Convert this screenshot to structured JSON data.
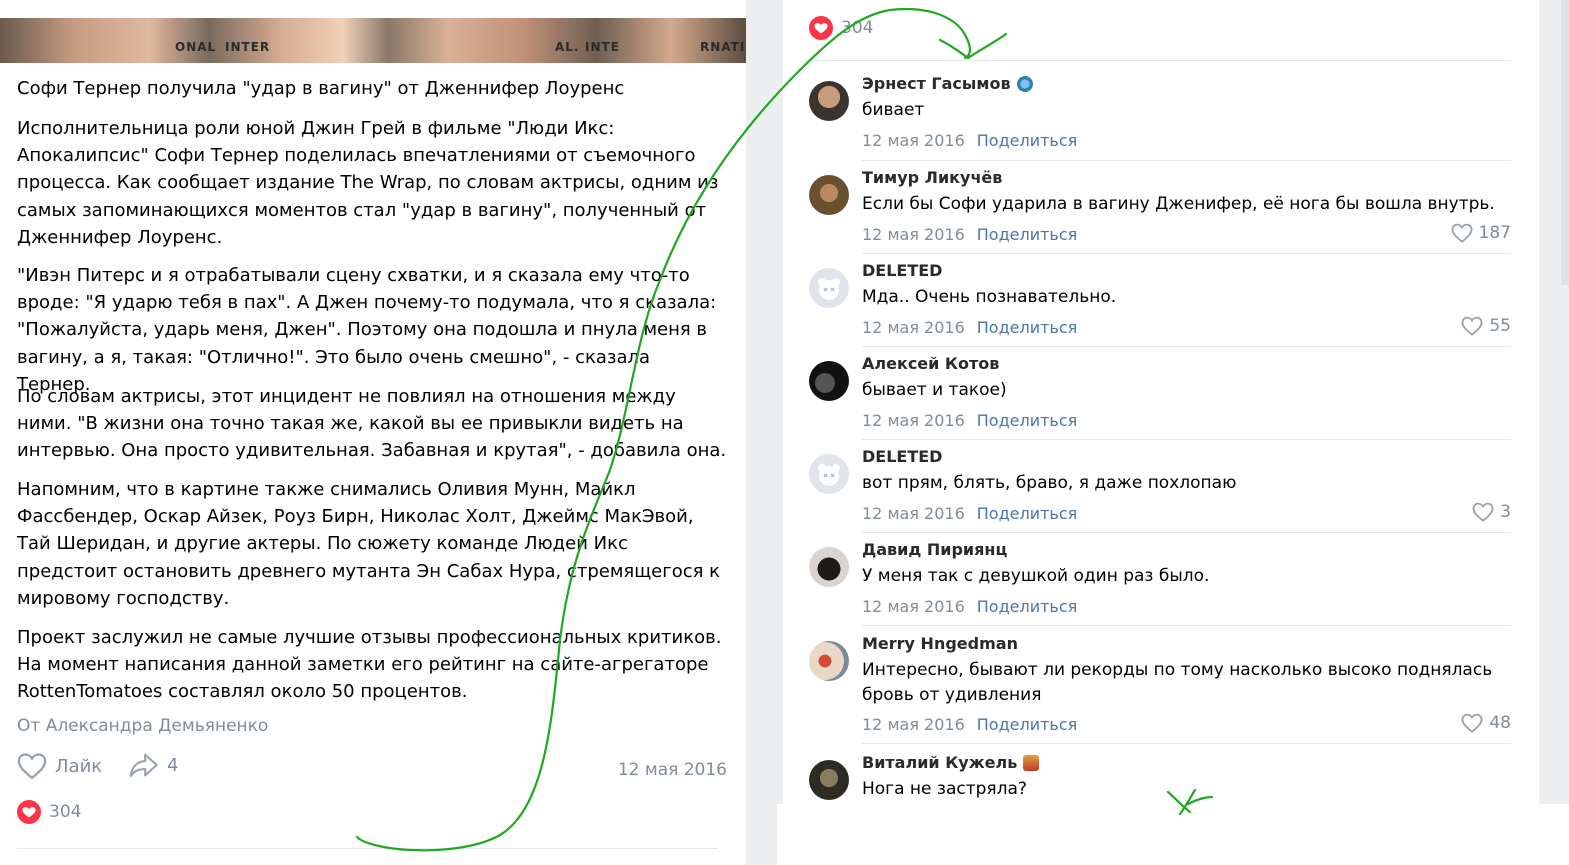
{
  "post": {
    "photo_labels": [
      "ONAL",
      "INTER",
      "AL.",
      "INTE",
      "RNATIO"
    ],
    "title": "Софи Тернер получила \"удар в вагину\" от Дженнифер Лоуренс",
    "paragraphs": [
      "Исполнительница роли юной Джин Грей в фильме \"Люди Икс: Апокалипсис\" Софи Тернер поделилась впечатлениями от съемочного процесса. Как сообщает издание The Wrap, по словам актрисы, одним из самых запоминающихся моментов стал \"удар в вагину\", полученный от Дженнифер Лоуренс.",
      "\"Ивэн Питерс и я отрабатывали сцену схватки, и я сказала ему что-то вроде: \"Я ударю тебя в пах\". А Джен почему-то подумала, что я сказала: \"Пожалуйста, ударь меня, Джен\". Поэтому она подошла и пнула меня в вагину, а я, такая: \"Отлично!\". Это было очень смешно\", - сказала Тернер.",
      "По словам актрисы, этот инцидент не повлиял на отношения между ними. \"В жизни она точно такая же, какой вы ее привыкли видеть на интервью. Она просто удивительная. Забавная и крутая\", - добавила она.",
      "Напомним, что в картине также снимались Оливия Мунн, Майкл Фассбендер, Оскар Айзек, Роуз Бирн, Николас Холт, Джеймс МакЭвой, Тай Шеридан, и другие актеры. По сюжету команде Людей Икс предстоит остановить древнего мутанта Эн Сабах Нура, стремящегося к мировому господству.",
      "Проект заслужил не самые лучшие отзывы профессиональных критиков. На момент написания данной заметки его рейтинг на сайте-агрегаторе RottenTomatoes составлял около 50 процентов."
    ],
    "author": "От Александра Демьяненко",
    "like_label": "Лайк",
    "share_count": "4",
    "date": "12 мая 2016",
    "likes_count": "304"
  },
  "comments": {
    "top_likes": "304",
    "share_label": "Поделиться",
    "items": [
      {
        "name": "Эрнест Гасымов",
        "text": "бивает",
        "date": "12 мая 2016",
        "likes": ""
      },
      {
        "name": "Тимур Ликучёв",
        "text": "Если бы Софи ударила в вагину Дженифер, её нога бы вошла внутрь.",
        "date": "12 мая 2016",
        "likes": "187"
      },
      {
        "name": "DELETED",
        "text": "Мда.. Очень познавательно.",
        "date": "12 мая 2016",
        "likes": "55"
      },
      {
        "name": "Алексей Котов",
        "text": "бывает и такое)",
        "date": "12 мая 2016",
        "likes": ""
      },
      {
        "name": "DELETED",
        "text": "вот прям, блять, браво, я даже похлопаю",
        "date": "12 мая 2016",
        "likes": "3"
      },
      {
        "name": "Давид Пириянц",
        "text": "У меня так с девушкой один раз было.",
        "date": "12 мая 2016",
        "likes": ""
      },
      {
        "name": "Merry Hngedman",
        "text": "Интересно, бывают ли рекорды по тому насколько высоко поднялась бровь от удивления",
        "date": "12 мая 2016",
        "likes": "48"
      },
      {
        "name": "Виталий Кужель",
        "text": "Нога не застряла?",
        "date": "",
        "likes": ""
      }
    ]
  },
  "colors": {
    "accent": "#4a76a8",
    "muted": "#818c99",
    "heart": "#e64646",
    "marker_green": "#1fa81f"
  }
}
